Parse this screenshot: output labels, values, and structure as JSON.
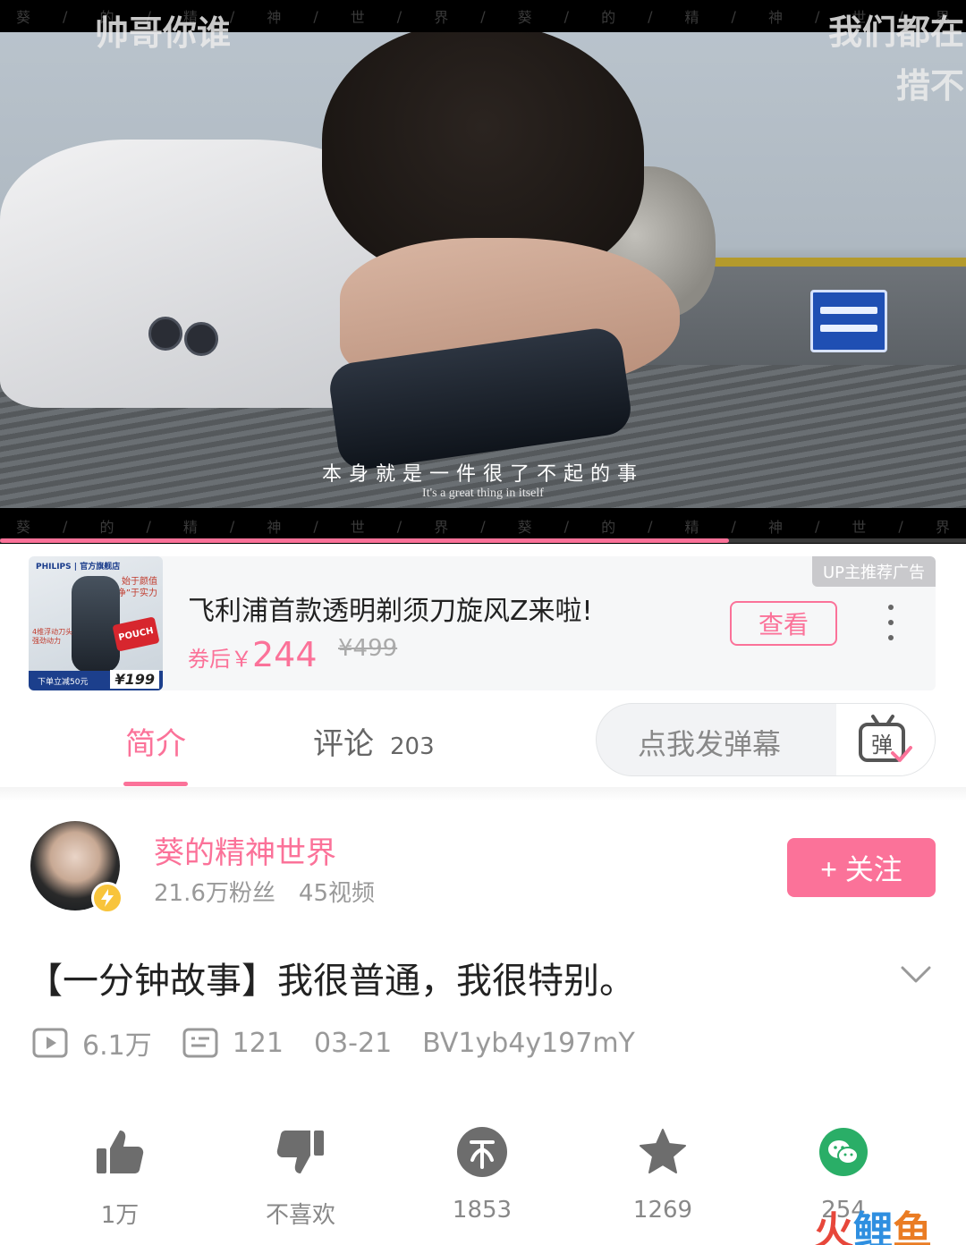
{
  "video": {
    "overlay_left": "帅哥你谁",
    "overlay_right_line1": "我们都在",
    "overlay_right_line2": "措不",
    "film_strip": [
      "葵",
      "/",
      "的",
      "/",
      "精",
      "/",
      "神",
      "/",
      "世",
      "/",
      "界",
      "/",
      "葵",
      "/",
      "的",
      "/",
      "精",
      "/",
      "神",
      "/",
      "世",
      "/",
      "界"
    ],
    "subtitle_cn": "本身就是一件很了不起的事",
    "subtitle_en": "It's a great thing in itself",
    "progress_fraction": 0.755,
    "progress_color": "#fb7299"
  },
  "ad": {
    "badge": "UP主推荐广告",
    "title": "飞利浦首款透明剃须刀旋风Z来啦!",
    "price_prefix": "券后￥",
    "price": "244",
    "old_price": "¥499",
    "button": "查看",
    "thumb_brand": "PHILIPS | 官方旗舰店",
    "thumb_slogan1": "始于颜值",
    "thumb_slogan2": "“净”于实力",
    "thumb_side1": "4维浮动刀头",
    "thumb_side2": "强劲动力",
    "thumb_pouch": "POUCH",
    "thumb_bar": "下单立减50元",
    "thumb_price": "¥199"
  },
  "tabs": {
    "intro": "简介",
    "comments": "评论",
    "comments_count": "203",
    "danmaku_placeholder": "点我发弹幕",
    "danmaku_icon_char": "弹"
  },
  "uploader": {
    "name": "葵的精神世界",
    "fans": "21.6万粉丝",
    "videos": "45视频",
    "follow": "+ 关注"
  },
  "details": {
    "title": "【一分钟故事】我很普通，我很特别。",
    "plays": "6.1万",
    "danmaku_count": "121",
    "date": "03-21",
    "bvid": "BV1yb4y197mY"
  },
  "actions": {
    "like": "1万",
    "dislike": "不喜欢",
    "coin": "1853",
    "favorite": "1269",
    "share": "254"
  },
  "watermark": {
    "c1": "火",
    "c2": "鲤",
    "c3": "鱼"
  },
  "colors": {
    "accent": "#fb7299",
    "icon_gray": "#6d6d6d",
    "share_green": "#2aae67"
  }
}
